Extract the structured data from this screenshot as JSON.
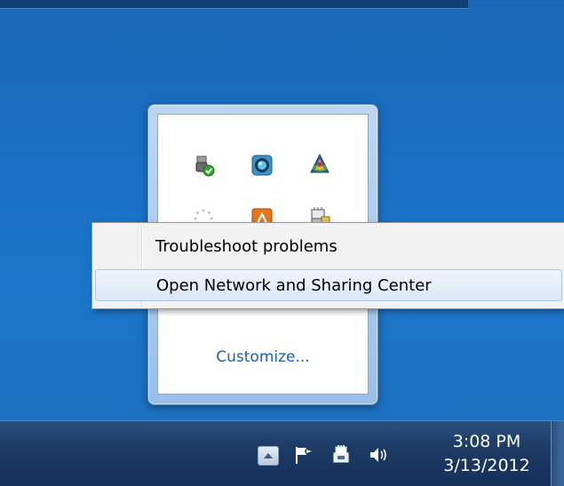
{
  "context_menu": {
    "items": [
      {
        "label": "Troubleshoot problems",
        "highlighted": false
      },
      {
        "label": "Open Network and Sharing Center",
        "highlighted": true
      }
    ]
  },
  "tray_popup": {
    "customize_label": "Customize...",
    "icons": [
      "usb-safely-remove-icon",
      "media-webcam-icon",
      "java-update-icon",
      "loading-spinner-icon",
      "orange-app-icon",
      "network-adapter-icon"
    ]
  },
  "taskbar": {
    "time": "3:08 PM",
    "date": "3/13/2012",
    "tray_icons": [
      "show-hidden-icons-button",
      "action-center-flag-icon",
      "network-plug-icon",
      "volume-icon"
    ]
  },
  "colors": {
    "desktop": "#1c6fc0",
    "taskbar": "#1c3a63",
    "link": "#1e5fb5",
    "menu_highlight": "#dbe8f7"
  }
}
